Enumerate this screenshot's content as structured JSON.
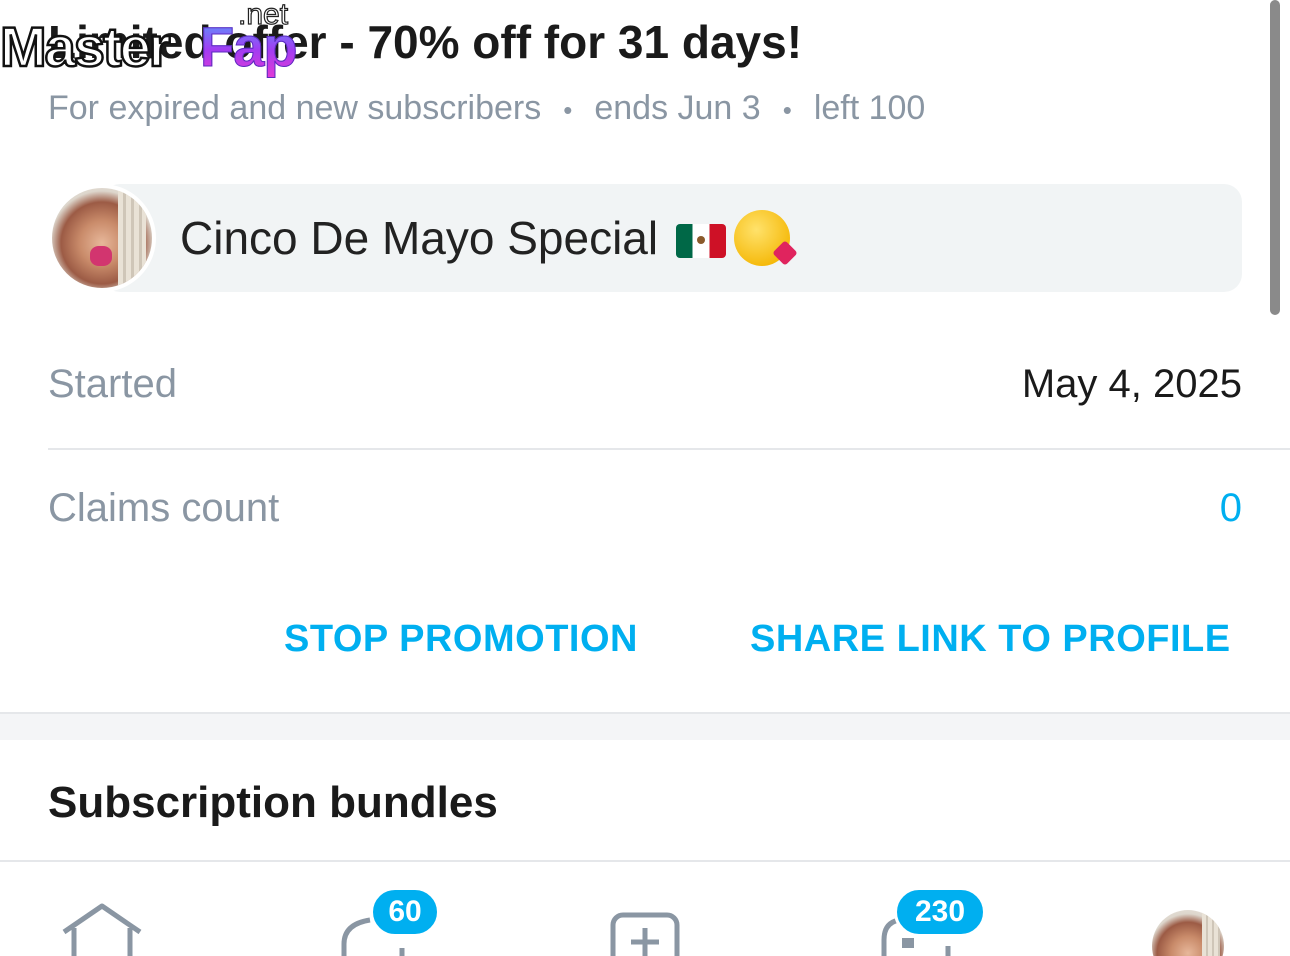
{
  "watermark": {
    "part1": "Master",
    "part2": "Fap",
    "part3": ".net"
  },
  "promo": {
    "title": "Limited offer - 70% off for 31 days!",
    "audience": "For expired and new subscribers",
    "ends": "ends Jun 3",
    "left": "left 100",
    "separator": "•",
    "message": "Cinco De Mayo Special"
  },
  "details": {
    "started_label": "Started",
    "started_value": "May 4, 2025",
    "claims_label": "Claims count",
    "claims_value": "0"
  },
  "actions": {
    "stop": "STOP PROMOTION",
    "share": "SHARE LINK TO PROFILE"
  },
  "sections": {
    "bundles_title": "Subscription bundles"
  },
  "bottom_nav": {
    "icons": [
      "home-icon",
      "messages-icon",
      "add-post-icon",
      "notifications-icon",
      "profile-avatar"
    ],
    "messages_badge": "60",
    "notifications_badge": "230"
  },
  "colors": {
    "accent": "#00aff0",
    "muted": "#8a96a3",
    "text": "#1a1a1a",
    "bubble": "#f1f4f5"
  }
}
